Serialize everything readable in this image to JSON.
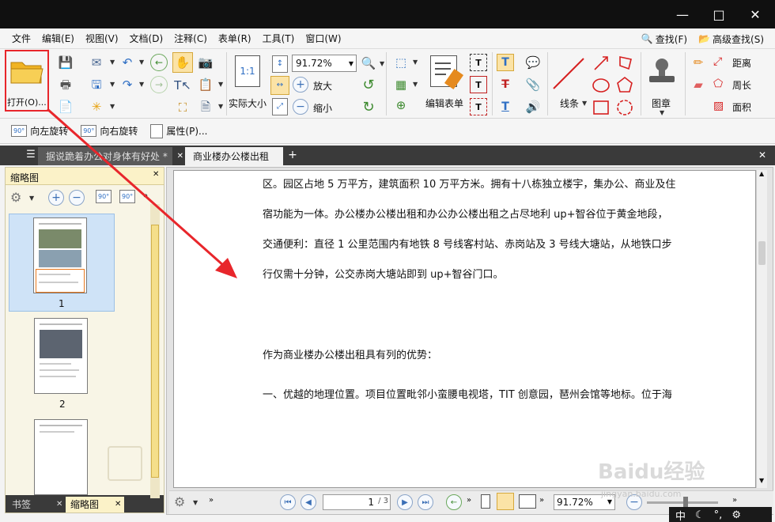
{
  "window": {
    "minimize_glyph": "—",
    "maximize_glyph": "□",
    "close_glyph": "✕"
  },
  "menu": {
    "items": [
      "文件",
      "编辑(E)",
      "视图(V)",
      "文档(D)",
      "注释(C)",
      "表单(R)",
      "工具(T)",
      "窗口(W)"
    ],
    "find": "查找(F)",
    "advanced_find": "高级查找(S)"
  },
  "ribbon": {
    "open_label": "打开(O)...",
    "zoom_value": "91.72%",
    "actual_size_icon_text": "1:1",
    "actual_size_label": "实际大小",
    "zoom_in_label": "放大",
    "zoom_out_label": "缩小",
    "edit_form_label": "编辑表单",
    "lines_label": "线条",
    "stamp_label": "图章",
    "distance_label": "距离",
    "perimeter_label": "周长",
    "area_label": "面积"
  },
  "toolbar2": {
    "rotate_left": "向左旋转",
    "rotate_right": "向右旋转",
    "properties": "属性(P)..."
  },
  "tabs": [
    {
      "label": "据说跪着办公对身体有好处 *"
    },
    {
      "label": "商业楼办公楼出租"
    }
  ],
  "left_panel": {
    "title": "缩略图",
    "pages": [
      "1",
      "2"
    ],
    "bottom_tabs": [
      "书签",
      "缩略图"
    ]
  },
  "document": {
    "lines": [
      "区。园区占地 5 万平方，建筑面积 10 万平方米。拥有十八栋独立楼宇，集办公、商业及住",
      "宿功能为一体。办公楼办公楼出租和办公办公楼出租之占尽地利 up+智谷位于黄金地段，",
      "交通便利：直径 1 公里范围内有地铁 8 号线客村站、赤岗站及 3 号线大塘站，从地铁口步",
      "行仅需十分钟，公交赤岗大塘站即到 up+智谷门口。",
      "作为商业楼办公楼出租具有列的优势：",
      "一、优越的地理位置。项目位置毗邻小蛮腰电视塔，TIT 创意园，琶州会馆等地标。位于海"
    ]
  },
  "status": {
    "page_input": "1",
    "page_total": "/ 3",
    "zoom_value": "91.72%",
    "ime": [
      "中"
    ]
  },
  "watermark": {
    "text": "Baidu经验",
    "url": "jingyan.baidu.com"
  },
  "colors": {
    "highlight_red": "#e8262b",
    "arrow_red": "#e8262b",
    "accent_blue": "#2f6fc4",
    "panel_yellow": "#f8f5e6"
  }
}
